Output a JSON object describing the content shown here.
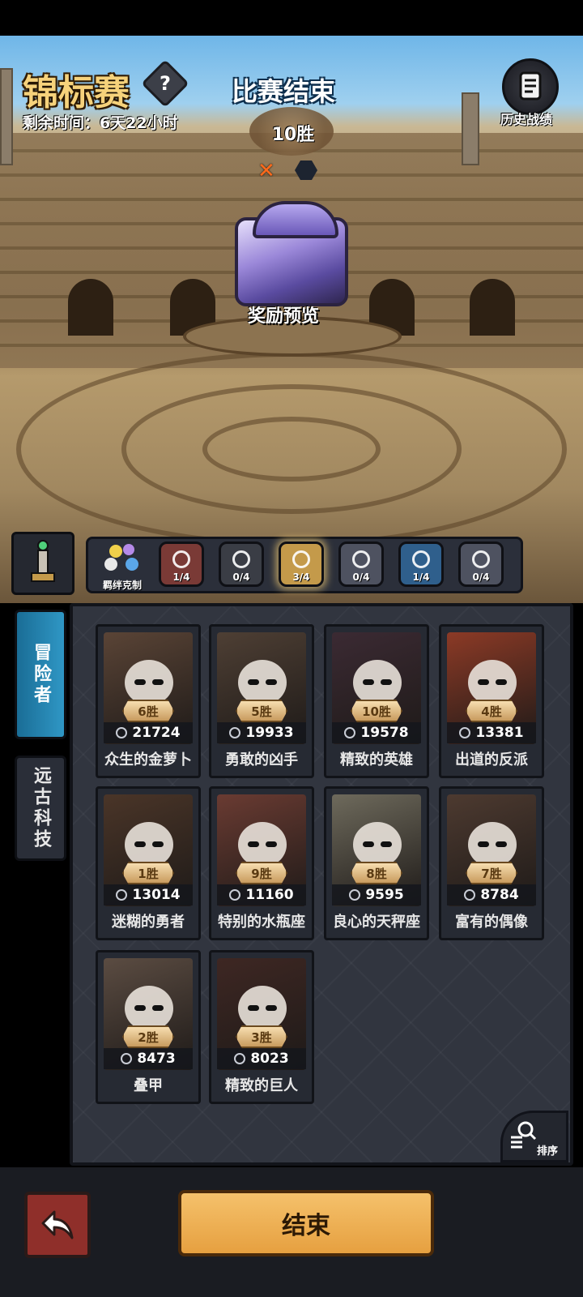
{
  "header": {
    "title": "锦标赛",
    "help_icon": "question-mark-icon",
    "help_glyph": "?",
    "remaining_time": "剩余时间：6天22小时",
    "history_label": "历史战绩"
  },
  "match": {
    "status": "比赛结束",
    "wins": "10胜",
    "loss_marker": "✕",
    "reward_preview": "奖励预览"
  },
  "synergy": {
    "bond_label": "羁绊克制",
    "items": [
      {
        "icon": "diamond-icon",
        "count": "1/4",
        "color": "#7a3a36"
      },
      {
        "icon": "eye-icon",
        "count": "0/4",
        "color": "#3a3d45"
      },
      {
        "icon": "crown-icon",
        "count": "3/4",
        "color": "#c49a4a"
      },
      {
        "icon": "arch-icon",
        "count": "0/4",
        "color": "#4e5260"
      },
      {
        "icon": "ring-icon",
        "count": "1/4",
        "color": "#2f5f8c"
      },
      {
        "icon": "bowtie-icon",
        "count": "0/4",
        "color": "#4e5260"
      }
    ]
  },
  "tabs": {
    "adventurer": "冒险者",
    "ancient_tech": "远古科技"
  },
  "heroes": [
    {
      "name": "众生的金萝卜",
      "wins": "6胜",
      "power": "21724",
      "bg": "#5a4436"
    },
    {
      "name": "勇敢的凶手",
      "wins": "5胜",
      "power": "19933",
      "bg": "#4e3f34"
    },
    {
      "name": "精致的英雄",
      "wins": "10胜",
      "power": "19578",
      "bg": "#3b2a33"
    },
    {
      "name": "出道的反派",
      "wins": "4胜",
      "power": "13381",
      "bg": "#8c3a26"
    },
    {
      "name": "迷糊的勇者",
      "wins": "1胜",
      "power": "13014",
      "bg": "#4a3528"
    },
    {
      "name": "特别的水瓶座",
      "wins": "9胜",
      "power": "11160",
      "bg": "#6a3b32"
    },
    {
      "name": "良心的天秤座",
      "wins": "8胜",
      "power": "9595",
      "bg": "#6e6a5c"
    },
    {
      "name": "富有的偶像",
      "wins": "7胜",
      "power": "8784",
      "bg": "#4d3a30"
    },
    {
      "name": "叠甲",
      "wins": "2胜",
      "power": "8473",
      "bg": "#5b4c42"
    },
    {
      "name": "精致的巨人",
      "wins": "3胜",
      "power": "8023",
      "bg": "#3e2723"
    }
  ],
  "sort_label": "排序",
  "footer": {
    "back_icon": "back-arrow-icon",
    "end_label": "结束"
  }
}
